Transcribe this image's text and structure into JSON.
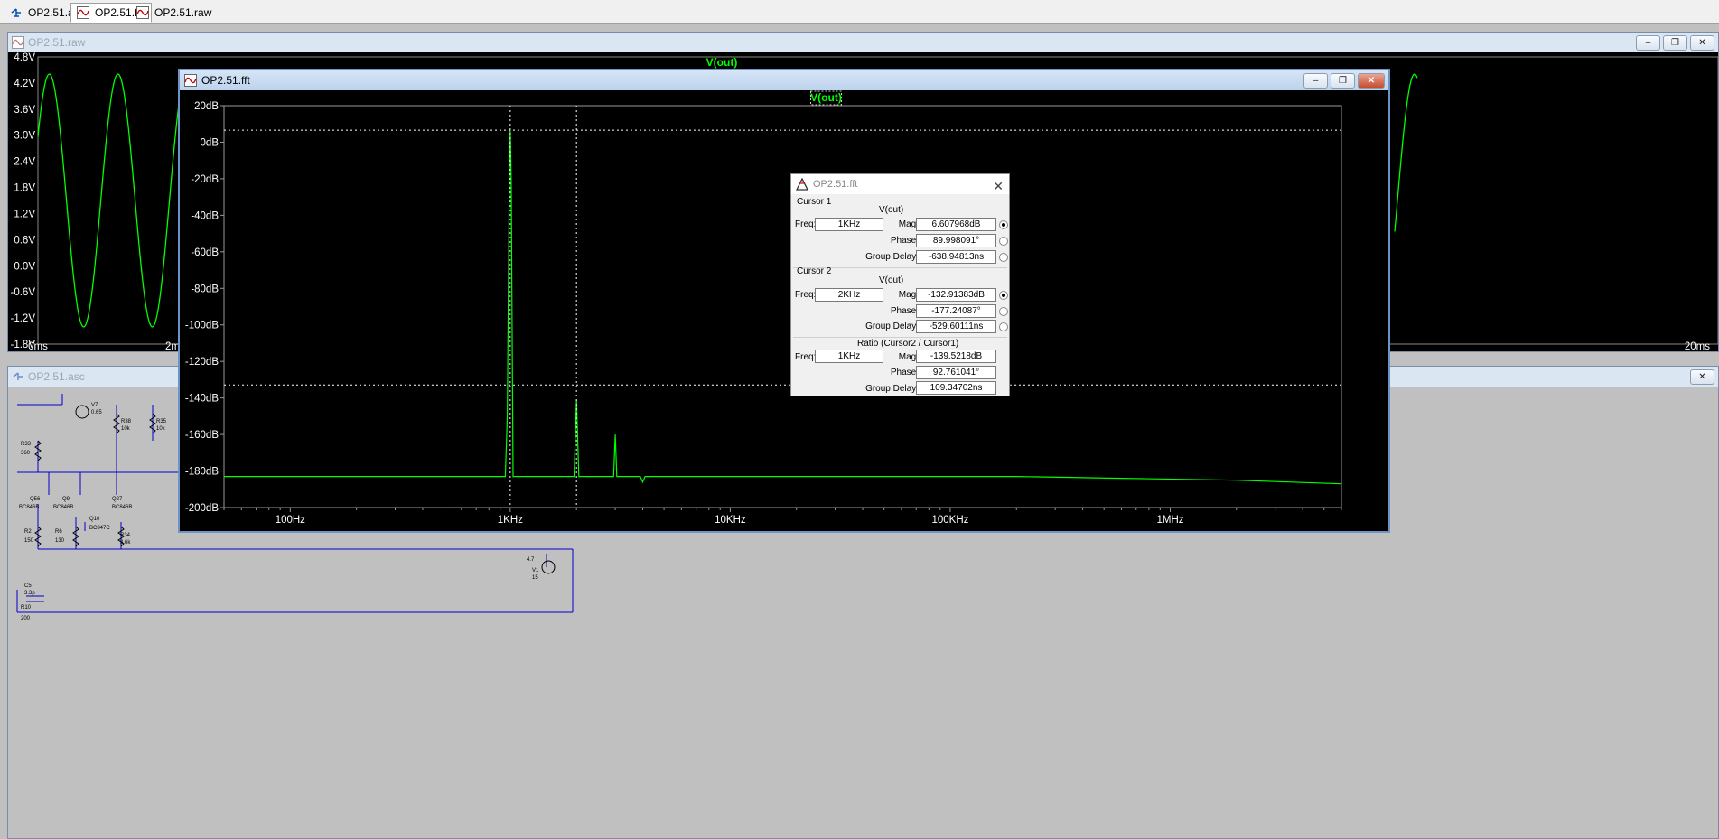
{
  "tabs": [
    {
      "label": "OP2.51.asc",
      "icon": "schematic-icon",
      "active": false
    },
    {
      "label": "OP2.51.fft",
      "icon": "waveform-icon",
      "active": true
    },
    {
      "label": "OP2.51.raw",
      "icon": "waveform-icon",
      "active": false
    }
  ],
  "raw_window": {
    "title": "OP2.51.raw",
    "trace_label": "V(out)",
    "y_ticks": [
      "4.8V",
      "4.2V",
      "3.6V",
      "3.0V",
      "2.4V",
      "1.8V",
      "1.2V",
      "0.6V",
      "0.0V",
      "-0.6V",
      "-1.2V",
      "-1.8V"
    ],
    "x_ticks": [
      "0ms",
      "2m",
      "20ms"
    ]
  },
  "asc_window": {
    "title": "OP2.51.asc",
    "components": [
      "R33",
      "360",
      "Q56",
      "BC846B",
      "Q9",
      "BC846B",
      "Q10",
      "BC847C",
      "Q27",
      "BC846B",
      "R38",
      "10k",
      "R35",
      "10k",
      "R2",
      "150",
      "R6",
      "130",
      "R34",
      "3.6k",
      "V1",
      "15",
      "4.7",
      "C5",
      "3.3p",
      "R10",
      "200",
      "V7",
      "0.65"
    ]
  },
  "fft_window": {
    "title": "OP2.51.fft",
    "trace_label": "V(out)",
    "trace_color": "#00ff00",
    "chart_data": {
      "type": "line",
      "title": "V(out)",
      "x_scale": "log",
      "x_ticks": [
        "100Hz",
        "1KHz",
        "10KHz",
        "100KHz",
        "1MHz"
      ],
      "y_ticks": [
        "20dB",
        "0dB",
        "-20dB",
        "-40dB",
        "-60dB",
        "-80dB",
        "-100dB",
        "-120dB",
        "-140dB",
        "-160dB",
        "-180dB",
        "-200dB"
      ],
      "ylim": [
        -200,
        20
      ],
      "xlim": [
        50,
        6000000
      ],
      "series": [
        {
          "values": [
            [
              50,
              -183
            ],
            [
              950,
              -183
            ],
            [
              970,
              -150
            ],
            [
              990,
              -20
            ],
            [
              1000,
              6.6
            ],
            [
              1010,
              -20
            ],
            [
              1030,
              -183
            ],
            [
              1950,
              -183
            ],
            [
              1990,
              -150
            ],
            [
              2000,
              -141
            ],
            [
              2010,
              -150
            ],
            [
              2050,
              -183
            ],
            [
              2950,
              -183
            ],
            [
              3000,
              -160
            ],
            [
              3050,
              -183
            ],
            [
              3900,
              -183
            ],
            [
              4000,
              -186
            ],
            [
              4100,
              -183
            ],
            [
              200000,
              -183
            ],
            [
              600000,
              -184
            ],
            [
              2000000,
              -185
            ],
            [
              6000000,
              -187
            ]
          ]
        }
      ],
      "cursors": {
        "cursor1": {
          "freq_hz": 1000,
          "mag_db": 6.607968
        },
        "cursor2": {
          "freq_hz": 2000,
          "mag_db": -132.91383
        }
      }
    }
  },
  "cursor_dialog": {
    "title": "OP2.51.fft",
    "cursor1": {
      "heading": "Cursor 1",
      "trace": "V(out)",
      "freq_label": "Freq:",
      "freq": "1KHz",
      "mag_label": "Mag:",
      "mag": "6.607968dB",
      "phase_label": "Phase:",
      "phase": "89.998091°",
      "gd_label": "Group Delay:",
      "gd": "-638.94813ns"
    },
    "cursor2": {
      "heading": "Cursor 2",
      "trace": "V(out)",
      "freq_label": "Freq:",
      "freq": "2KHz",
      "mag_label": "Mag:",
      "mag": "-132.91383dB",
      "phase_label": "Phase:",
      "phase": "-177.24087°",
      "gd_label": "Group Delay:",
      "gd": "-529.60111ns"
    },
    "ratio": {
      "heading": "Ratio (Cursor2 / Cursor1)",
      "freq_label": "Freq:",
      "freq": "1KHz",
      "mag_label": "Mag:",
      "mag": "-139.5218dB",
      "phase_label": "Phase:",
      "phase": "92.761041°",
      "gd_label": "Group Delay:",
      "gd": "109.34702ns"
    }
  }
}
